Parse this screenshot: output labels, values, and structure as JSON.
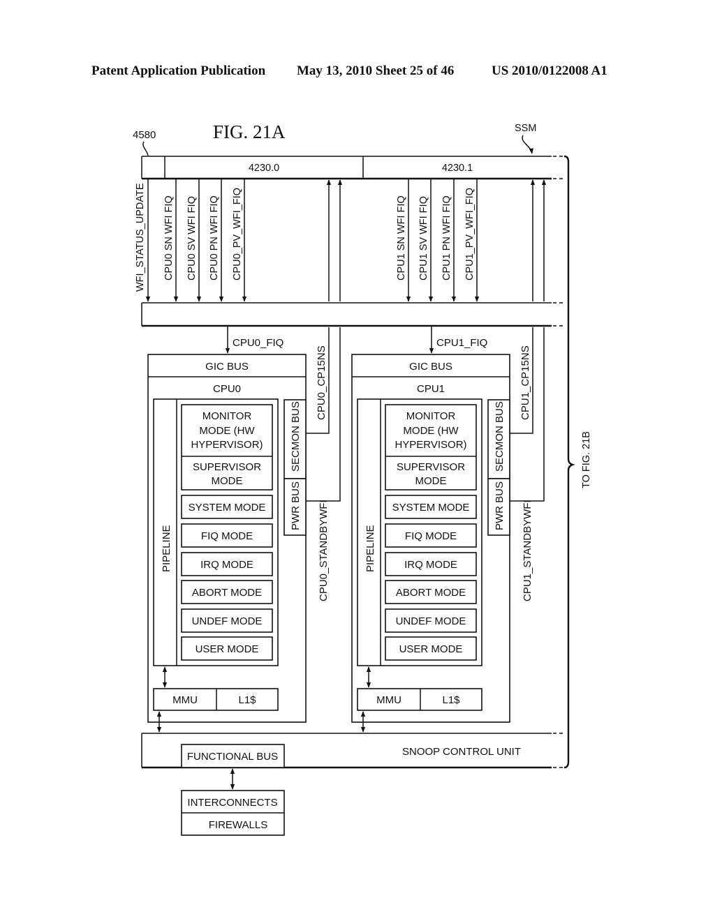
{
  "header": {
    "publication": "Patent Application Publication",
    "date_sheet": "May 13, 2010  Sheet 25 of 46",
    "patent_number": "US 2010/0122008 A1"
  },
  "figure": {
    "title": "FIG. 21A",
    "ref_4580": "4580",
    "ref_ssm": "SSM",
    "continuation": "TO FIG. 21B"
  },
  "ssm_bar": {
    "segments": [
      "4230.0",
      "4230.1"
    ]
  },
  "signals": {
    "wfi_status_update": "WFI_STATUS_UPDATE",
    "cpu0_down": [
      "CPU0 SN WFI FIQ",
      "CPU0 SV WFI FIQ",
      "CPU0 PN WFI FIQ",
      "CPU0_PV_WFI_FIQ"
    ],
    "cpu1_down": [
      "CPU1 SN WFI FIQ",
      "CPU1 SV WFI FIQ",
      "CPU1 PN WFI FIQ",
      "CPU1_PV_WFI_FIQ"
    ],
    "cpu0_fiq": "CPU0_FIQ",
    "cpu1_fiq": "CPU1_FIQ",
    "cpu0_cp15ns": "CPU0_CP15NS",
    "cpu1_cp15ns": "CPU1_CP15NS",
    "cpu0_standbywfi": "CPU0_STANDBYWFI",
    "cpu1_standbywfi": "CPU1_STANDBYWFI"
  },
  "cpus": [
    {
      "name": "CPU0",
      "gic_bus": "GIC BUS",
      "pipeline": "PIPELINE",
      "secmon_bus": "SECMON BUS",
      "pwr_bus": "PWR BUS",
      "monitor_mode": [
        "MONITOR",
        "MODE (HW",
        "HYPERVISOR)"
      ],
      "supervisor_mode": [
        "SUPERVISOR",
        "MODE"
      ],
      "modes": [
        "SYSTEM MODE",
        "FIQ MODE",
        "IRQ MODE",
        "ABORT MODE",
        "UNDEF MODE",
        "USER MODE"
      ],
      "mmu": "MMU",
      "l1": "L1$"
    },
    {
      "name": "CPU1",
      "gic_bus": "GIC BUS",
      "pipeline": "PIPELINE",
      "secmon_bus": "SECMON BUS",
      "pwr_bus": "PWR BUS",
      "monitor_mode": [
        "MONITOR",
        "MODE (HW",
        "HYPERVISOR)"
      ],
      "supervisor_mode": [
        "SUPERVISOR",
        "MODE"
      ],
      "modes": [
        "SYSTEM MODE",
        "FIQ MODE",
        "IRQ MODE",
        "ABORT MODE",
        "UNDEF MODE",
        "USER MODE"
      ],
      "mmu": "MMU",
      "l1": "L1$"
    }
  ],
  "scu": {
    "label": "SNOOP CONTROL UNIT",
    "functional_bus": "FUNCTIONAL BUS"
  },
  "interconnect": {
    "top": "INTERCONNECTS",
    "bottom": "FIREWALLS"
  }
}
